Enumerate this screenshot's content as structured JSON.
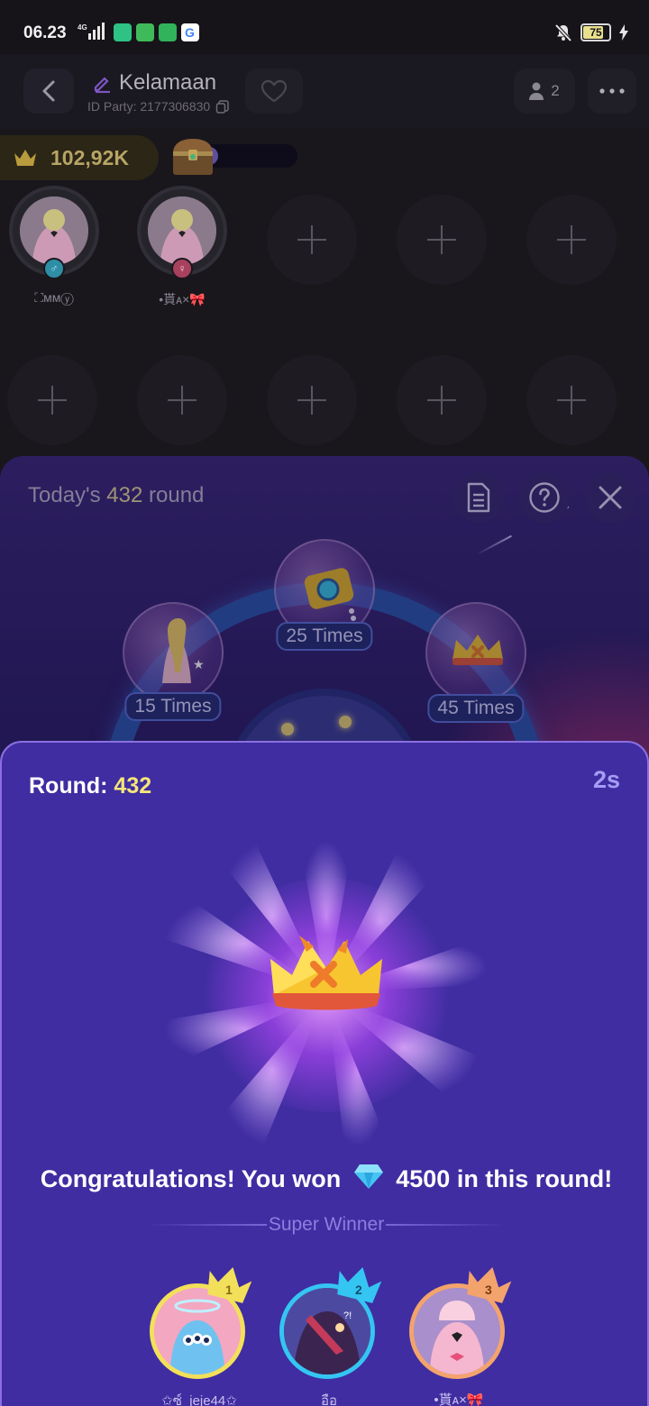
{
  "status_bar": {
    "time": "06.23",
    "network": "4G",
    "battery": "75"
  },
  "room": {
    "title": "Kelamaan",
    "id_label": "ID Party: 2177306830",
    "members": "2",
    "coins": "102,92K"
  },
  "seats": [
    {
      "name": "⛶︎ᴍᴍⓨ",
      "gender": "male"
    },
    {
      "name": "•貰ᴀ×🎀",
      "gender": "female"
    }
  ],
  "game": {
    "today_prefix": "Today's",
    "today_round": "432",
    "today_suffix": "round",
    "prizes": [
      {
        "times": "15 Times",
        "icon": "princess-figure-icon"
      },
      {
        "times": "25 Times",
        "icon": "camera-icon"
      },
      {
        "times": "45 Times",
        "icon": "crown-icon"
      }
    ]
  },
  "result": {
    "round_label": "Round:",
    "round_value": "432",
    "countdown": "2s",
    "congrats_before": "Congratulations! You won",
    "amount": "4500",
    "congrats_after": "in this round!",
    "super_winner_label": "Super Winner",
    "winners": [
      {
        "rank": "1",
        "name": "✩ซ์_jeje44✩"
      },
      {
        "rank": "2",
        "name": "อือ"
      },
      {
        "rank": "3",
        "name": "•貰ᴀ×🎀"
      }
    ]
  },
  "colors": {
    "accent_yellow": "#f5e57a",
    "panel_purple": "#3f2da1",
    "rank1": "#f3e05a",
    "rank2": "#35c5f2",
    "rank3": "#f3a36c"
  }
}
